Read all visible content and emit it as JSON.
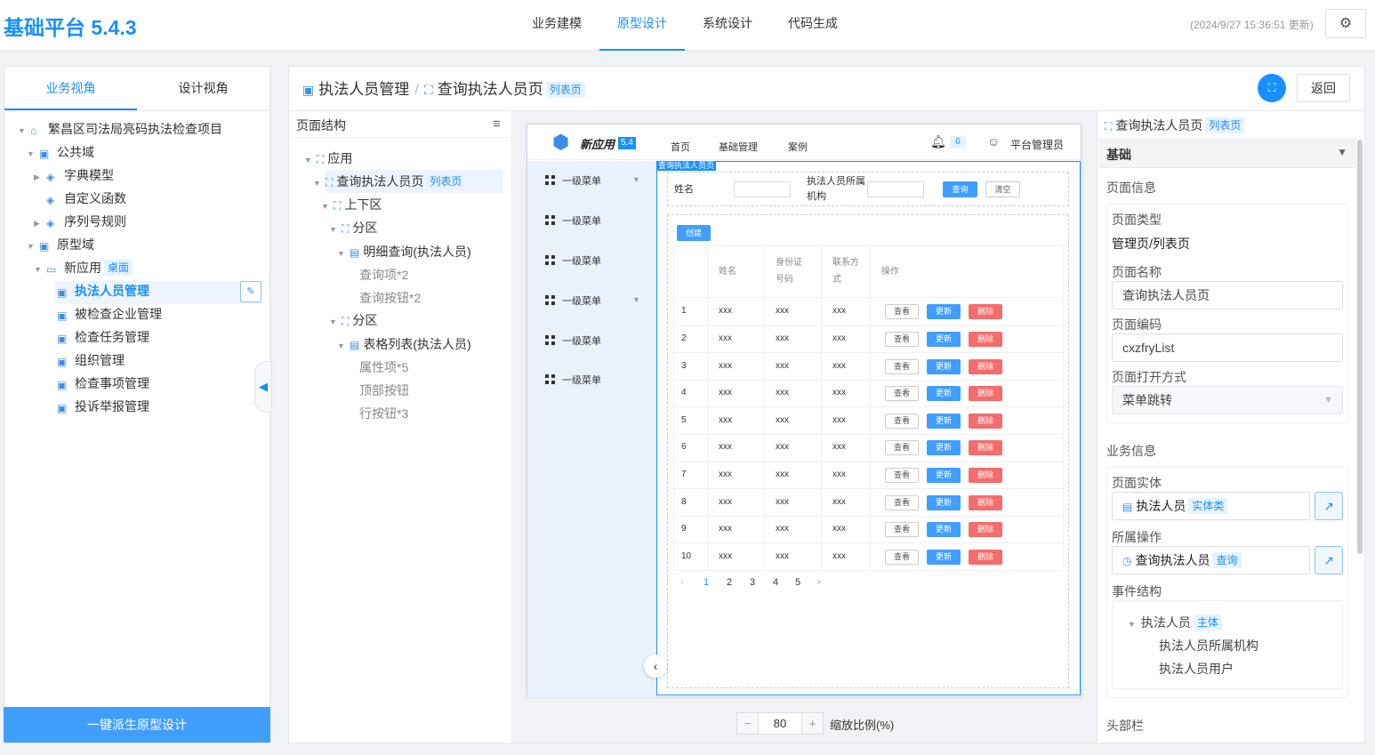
{
  "app": {
    "title": "基础平台 5.4.3",
    "update_time": "(2024/9/27 15:36:51 更新)"
  },
  "topnav": [
    "业务建模",
    "原型设计",
    "系统设计",
    "代码生成"
  ],
  "left": {
    "tabs": [
      "业务视角",
      "设计视角"
    ],
    "tree": {
      "project": "繁昌区司法局亮码执法检查项目",
      "public_domain": "公共域",
      "dict_model": "字典模型",
      "custom_func": "自定义函数",
      "seq_rule": "序列号规则",
      "proto_domain": "原型域",
      "new_app": "新应用",
      "new_app_tag": "桌面",
      "pages": [
        "执法人员管理",
        "被检查企业管理",
        "检查任务管理",
        "组织管理",
        "检查事项管理",
        "投诉举报管理"
      ]
    },
    "derive_button": "一键派生原型设计"
  },
  "breadcrumb": {
    "first": "执法人员管理",
    "sep": "/",
    "second": "查询执法人员页",
    "tag": "列表页"
  },
  "back_button": "返回",
  "structure": {
    "title": "页面结构",
    "nodes": {
      "app": "应用",
      "page": "查询执法人员页",
      "page_tag": "列表页",
      "updown": "上下区",
      "part1": "分区",
      "detail_query": "明细查询(执法人员)",
      "query_items": "查询项*2",
      "query_buttons": "查询按钮*2",
      "part2": "分区",
      "table_list": "表格列表(执法人员)",
      "attr_items": "属性项*5",
      "top_buttons": "顶部按钮",
      "row_buttons": "行按钮*3"
    }
  },
  "preview": {
    "app_name": "新应用",
    "app_version": "5.4",
    "nav": [
      "首页",
      "基础管理",
      "案例"
    ],
    "bell_count": "6",
    "user": "平台管理员",
    "menu": [
      "一级菜单",
      "一级菜单",
      "一级菜单",
      "一级菜单",
      "一级菜单",
      "一级菜单"
    ],
    "selected_label": "查询执法人员页",
    "query": {
      "name_label": "姓名",
      "org_label_1": "执法人员所属",
      "org_label_2": "机构",
      "search_btn": "查询",
      "clear_btn": "清空"
    },
    "create_btn": "创建",
    "columns": {
      "name": "姓名",
      "id_1": "身份证",
      "id_2": "号码",
      "phone_1": "联系方",
      "phone_2": "式",
      "ops": "操作"
    },
    "rows": [
      {
        "no": "1",
        "name": "xxx",
        "id": "xxx",
        "phone": "xxx"
      },
      {
        "no": "2",
        "name": "xxx",
        "id": "xxx",
        "phone": "xxx"
      },
      {
        "no": "3",
        "name": "xxx",
        "id": "xxx",
        "phone": "xxx"
      },
      {
        "no": "4",
        "name": "xxx",
        "id": "xxx",
        "phone": "xxx"
      },
      {
        "no": "5",
        "name": "xxx",
        "id": "xxx",
        "phone": "xxx"
      },
      {
        "no": "6",
        "name": "xxx",
        "id": "xxx",
        "phone": "xxx"
      },
      {
        "no": "7",
        "name": "xxx",
        "id": "xxx",
        "phone": "xxx"
      },
      {
        "no": "8",
        "name": "xxx",
        "id": "xxx",
        "phone": "xxx"
      },
      {
        "no": "9",
        "name": "xxx",
        "id": "xxx",
        "phone": "xxx"
      },
      {
        "no": "10",
        "name": "xxx",
        "id": "xxx",
        "phone": "xxx"
      }
    ],
    "row_ops": {
      "view": "查看",
      "update": "更新",
      "delete": "删除"
    },
    "pages": [
      "1",
      "2",
      "3",
      "4",
      "5"
    ]
  },
  "zoom": {
    "value": "80",
    "label": "缩放比例(%)"
  },
  "props": {
    "title": "查询执法人员页",
    "title_tag": "列表页",
    "section": "基础",
    "page_info": "页面信息",
    "page_type_label": "页面类型",
    "page_type_value": "管理页/列表页",
    "page_name_label": "页面名称",
    "page_name_value": "查询执法人员页",
    "page_code_label": "页面编码",
    "page_code_value": "cxzfryList",
    "open_mode_label": "页面打开方式",
    "open_mode_value": "菜单跳转",
    "biz_info": "业务信息",
    "entity_label": "页面实体",
    "entity_value": "执法人员",
    "entity_tag": "实体类",
    "op_label": "所属操作",
    "op_value": "查询执法人员",
    "op_tag": "查询",
    "event_label": "事件结构",
    "event_root": "执法人员",
    "event_root_tag": "主体",
    "event_children": [
      "执法人员所属机构",
      "执法人员用户"
    ],
    "header_bar": "头部栏"
  }
}
